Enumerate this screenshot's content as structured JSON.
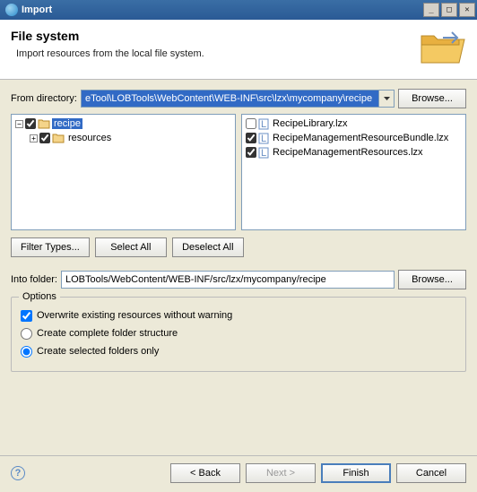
{
  "window": {
    "title": "Import"
  },
  "header": {
    "title": "File system",
    "subtitle": "Import resources from the local file system."
  },
  "from": {
    "label": "From directory:",
    "value": "eTool\\LOBTools\\WebContent\\WEB-INF\\src\\lzx\\mycompany\\recipe",
    "browse": "Browse..."
  },
  "left_tree": {
    "items": [
      {
        "label": "recipe",
        "checked": true,
        "expanded": true,
        "selected": true
      },
      {
        "label": "resources",
        "checked": true,
        "expanded": false,
        "indent": 1
      }
    ]
  },
  "right_tree": {
    "items": [
      {
        "label": "RecipeLibrary.lzx",
        "checked": false
      },
      {
        "label": "RecipeManagementResourceBundle.lzx",
        "checked": true
      },
      {
        "label": "RecipeManagementResources.lzx",
        "checked": true
      }
    ]
  },
  "buttons": {
    "filter": "Filter Types...",
    "select_all": "Select All",
    "deselect_all": "Deselect All"
  },
  "into": {
    "label": "Into folder:",
    "value": "LOBTools/WebContent/WEB-INF/src/lzx/mycompany/recipe",
    "browse": "Browse..."
  },
  "options": {
    "legend": "Options",
    "overwrite": "Overwrite existing resources without warning",
    "complete": "Create complete folder structure",
    "selected": "Create selected folders only"
  },
  "footer": {
    "back": "< Back",
    "next": "Next >",
    "finish": "Finish",
    "cancel": "Cancel"
  }
}
